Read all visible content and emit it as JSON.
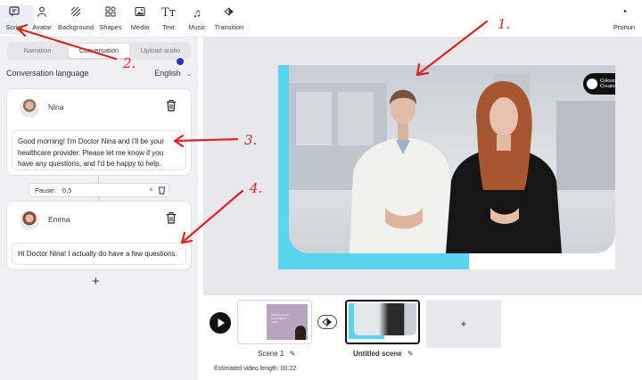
{
  "toolbar": {
    "items": [
      {
        "label": "Script",
        "icon": "script-icon"
      },
      {
        "label": "Avatar",
        "icon": "avatar-icon"
      },
      {
        "label": "Background",
        "icon": "background-icon"
      },
      {
        "label": "Shapes",
        "icon": "shapes-icon"
      },
      {
        "label": "Media",
        "icon": "media-icon"
      },
      {
        "label": "Text",
        "icon": "text-icon"
      },
      {
        "label": "Music",
        "icon": "music-icon"
      },
      {
        "label": "Transition",
        "icon": "transition-icon"
      }
    ],
    "pronunciation_label": "Pronun"
  },
  "tabs": {
    "narration": "Narration",
    "conversation": "Conversation",
    "upload_audio": "Upload audio"
  },
  "language": {
    "label": "Conversation language",
    "value": "English"
  },
  "dialogue": [
    {
      "speaker": "Nina",
      "text": "Good morning! I'm Doctor Nina and I'll be your healthcare provider. Please let me know if you have any questions, and I'd be happy to help."
    },
    {
      "speaker": "Emma",
      "text": "Hi Doctor Nina! I actually do have a few questions."
    }
  ],
  "pause": {
    "label": "Pause:",
    "value": "0,5",
    "unit": "s"
  },
  "add_line_label": "+",
  "video": {
    "logo_text": "Colossyan Creator™"
  },
  "timeline": {
    "scenes": [
      {
        "label": "Scene 1",
        "thumb_text": "Welcome to my wonderful to video"
      },
      {
        "label": "Untitled scene"
      }
    ],
    "add_scene_label": "+",
    "estimate": "Estimated video length: 00:22"
  },
  "annotations": [
    "1.",
    "2.",
    "3.",
    "4."
  ],
  "colors": {
    "accent_cyan": "#5ad5ef",
    "annotation_red": "#d9231d",
    "panel": "#f1f1f4"
  }
}
